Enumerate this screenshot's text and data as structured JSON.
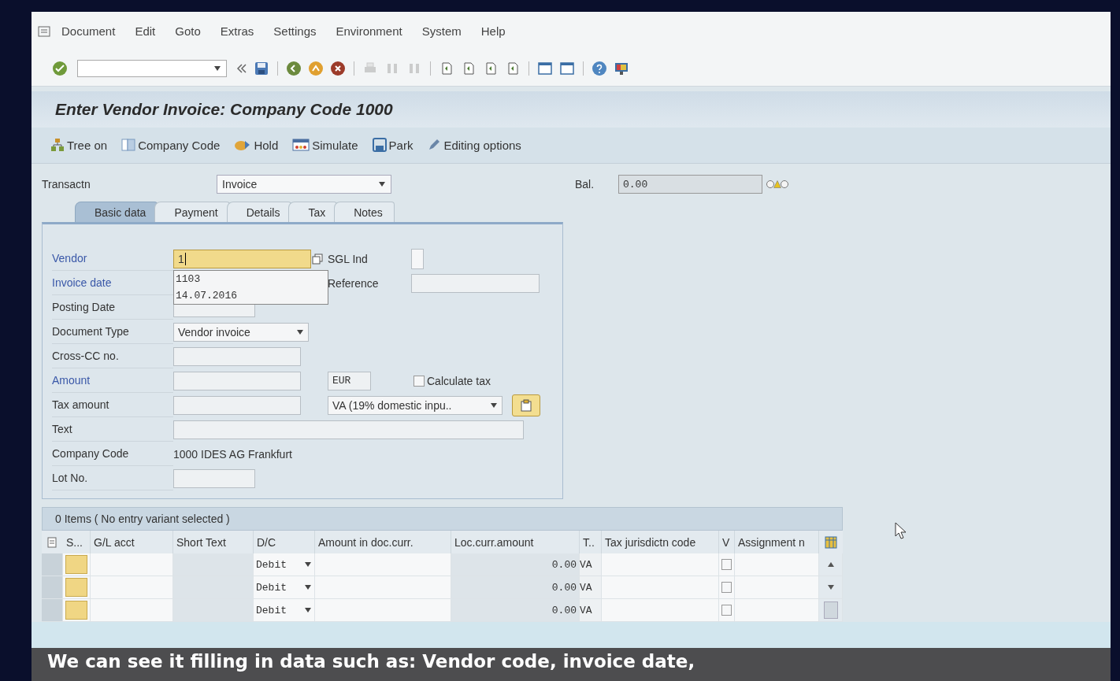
{
  "menu": [
    "Document",
    "Edit",
    "Goto",
    "Extras",
    "Settings",
    "Environment",
    "System",
    "Help"
  ],
  "title": "Enter Vendor Invoice: Company Code 1000",
  "app_toolbar": [
    {
      "label": "Tree on"
    },
    {
      "label": "Company Code"
    },
    {
      "label": "Hold"
    },
    {
      "label": "Simulate"
    },
    {
      "label": "Park"
    },
    {
      "label": "Editing options"
    }
  ],
  "transaction": {
    "label": "Transactn",
    "value": "Invoice"
  },
  "balance": {
    "label": "Bal.",
    "value": "0.00"
  },
  "tabs": [
    {
      "label": "Basic data",
      "selected": true
    },
    {
      "label": "Payment",
      "selected": false
    },
    {
      "label": "Details",
      "selected": false
    },
    {
      "label": "Tax",
      "selected": false
    },
    {
      "label": "Notes",
      "selected": false
    }
  ],
  "form": [
    {
      "kind": "input",
      "label": "Vendor",
      "required": true,
      "value": "1",
      "focused": true,
      "suggestions": [
        "1103",
        "14.07.2016"
      ],
      "side": {
        "kind": "indicator",
        "label": "SGL Ind"
      }
    },
    {
      "kind": "covered",
      "label": "Invoice date",
      "required": true,
      "side": {
        "kind": "label-input",
        "label": "Reference"
      }
    },
    {
      "kind": "short-input",
      "label": "Posting Date",
      "required": false
    },
    {
      "kind": "select",
      "label": "Document Type",
      "required": false,
      "value": "Vendor invoice"
    },
    {
      "kind": "input",
      "label": "Cross-CC no.",
      "required": false
    },
    {
      "kind": "input",
      "label": "Amount",
      "required": true,
      "side": {
        "kind": "currency-check",
        "currency": "EUR",
        "check_label": "Calculate tax",
        "checked": false
      }
    },
    {
      "kind": "input",
      "label": "Tax amount",
      "required": false,
      "side": {
        "kind": "select-button",
        "value": "VA (19% domestic inpu.."
      }
    },
    {
      "kind": "wide-input",
      "label": "Text",
      "required": false
    },
    {
      "kind": "text",
      "label": "Company Code",
      "required": false,
      "value": "1000 IDES AG Frankfurt"
    },
    {
      "kind": "short-input",
      "label": "Lot No.",
      "required": false
    }
  ],
  "items": {
    "title": "0 Items ( No entry variant selected )",
    "columns": [
      "S...",
      "G/L acct",
      "Short Text",
      "D/C",
      "Amount in doc.curr.",
      "Loc.curr.amount",
      "T..",
      "Tax jurisdictn code",
      "V",
      "Assignment n"
    ],
    "rows": [
      {
        "dc": "Debit",
        "loc_amount": "0.00",
        "tax_code": "VA",
        "checked": false
      },
      {
        "dc": "Debit",
        "loc_amount": "0.00",
        "tax_code": "VA",
        "checked": false
      },
      {
        "dc": "Debit",
        "loc_amount": "0.00",
        "tax_code": "VA",
        "checked": false
      }
    ]
  },
  "caption": "We can see it filling in data such as: Vendor code, invoice date,"
}
